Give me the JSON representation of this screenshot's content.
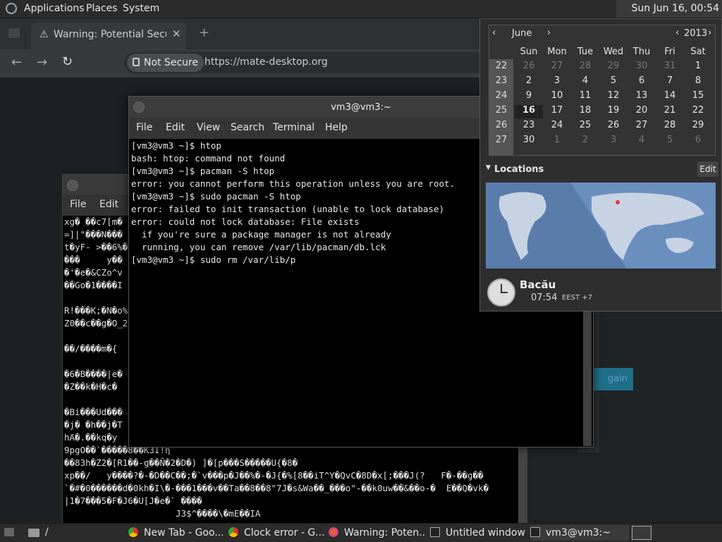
{
  "top_panel": {
    "menus": [
      "Applications",
      "Places",
      "System"
    ],
    "clock": "Sun Jun 16, 00:54"
  },
  "browser": {
    "tab_title": "Warning: Potential Security",
    "not_secure": "Not Secure",
    "url": "https://mate-desktop.org",
    "button_partial": "gain"
  },
  "term_back": {
    "menu": [
      "File",
      "Edit"
    ],
    "lines": [
      "xg� ��c7[m�",
      "=]|\"���N���",
      "t�yF- >��6%�",
      "���     y��",
      "�'�e�&CZo^v",
      "��Go�1����I",
      "",
      "R!���K;�N�o%",
      "Z0��c��g�O_2",
      "",
      "��/����m�{",
      "",
      "�6�B����|e�",
      "�Z��k�H�c�",
      "",
      "�Bi���Ud���",
      "�j� �h��j�T",
      "hA�.��kq�y",
      "9pgO��`�����8��K3I!η",
      "��83h�Z2�[R1��-g��Ñ�2�D�) ]�[p���S�����U{�8�",
      "xp��/   y����?�-�D��C��;�`v���p�J��%�-�J{�%[8��iT^Y�QvC�8D�x[;���J(?   F�-��g��",
      "`�#�0������d�0kh�I\\�-���1���v��Ta��8��8\"7J�s&Wa��_���o\"-��k0uw��&��o-�  E��Q�vk�",
      "|1�7���5�F�J6�U[J�e�` ����",
      "                     J3$^����\\�mE��IA"
    ]
  },
  "term_front": {
    "title": "vm3@vm3:~",
    "menu": [
      "File",
      "Edit",
      "View",
      "Search",
      "Terminal",
      "Help"
    ],
    "lines": [
      "[vm3@vm3 ~]$ htop",
      "bash: htop: command not found",
      "[vm3@vm3 ~]$ pacman -S htop",
      "error: you cannot perform this operation unless you are root.",
      "[vm3@vm3 ~]$ sudo pacman -S htop",
      "error: failed to init transaction (unable to lock database)",
      "error: could not lock database: File exists",
      "  if you're sure a package manager is not already",
      "  running, you can remove /var/lib/pacman/db.lck",
      "[vm3@vm3 ~]$ sudo rm /var/lib/p"
    ]
  },
  "calendar": {
    "month": "June",
    "year": "2013",
    "weekdays": [
      "Sun",
      "Mon",
      "Tue",
      "Wed",
      "Thu",
      "Fri",
      "Sat"
    ],
    "weeks": [
      "22",
      "23",
      "24",
      "25",
      "26",
      "27"
    ],
    "rows": [
      [
        "26",
        "27",
        "28",
        "29",
        "30",
        "31",
        "1"
      ],
      [
        "2",
        "3",
        "4",
        "5",
        "6",
        "7",
        "8"
      ],
      [
        "9",
        "10",
        "11",
        "12",
        "13",
        "14",
        "15"
      ],
      [
        "16",
        "17",
        "18",
        "19",
        "20",
        "21",
        "22"
      ],
      [
        "23",
        "24",
        "25",
        "26",
        "27",
        "28",
        "29"
      ],
      [
        "30",
        "1",
        "2",
        "3",
        "4",
        "5",
        "6"
      ]
    ],
    "dim_rows": [
      [
        true,
        true,
        true,
        true,
        true,
        true,
        false
      ],
      [
        false,
        false,
        false,
        false,
        false,
        false,
        false
      ],
      [
        false,
        false,
        false,
        false,
        false,
        false,
        false
      ],
      [
        false,
        false,
        false,
        false,
        false,
        false,
        false
      ],
      [
        false,
        false,
        false,
        false,
        false,
        false,
        false
      ],
      [
        false,
        true,
        true,
        true,
        true,
        true,
        true
      ]
    ],
    "today": "16",
    "locations_label": "Locations",
    "edit_label": "Edit",
    "city": "Bacău",
    "city_time": "07:54",
    "city_tz": "EEST +7"
  },
  "bottom_panel": {
    "folder_label": "/",
    "tasks": [
      "New Tab - Goo...",
      "Clock error - G...",
      "Warning: Poten...",
      "Untitled window",
      "vm3@vm3:~"
    ]
  },
  "colors": {
    "accent": "#1f6f8b",
    "map_ocean": "#6a8fbf",
    "map_land": "#c7d3e3"
  }
}
